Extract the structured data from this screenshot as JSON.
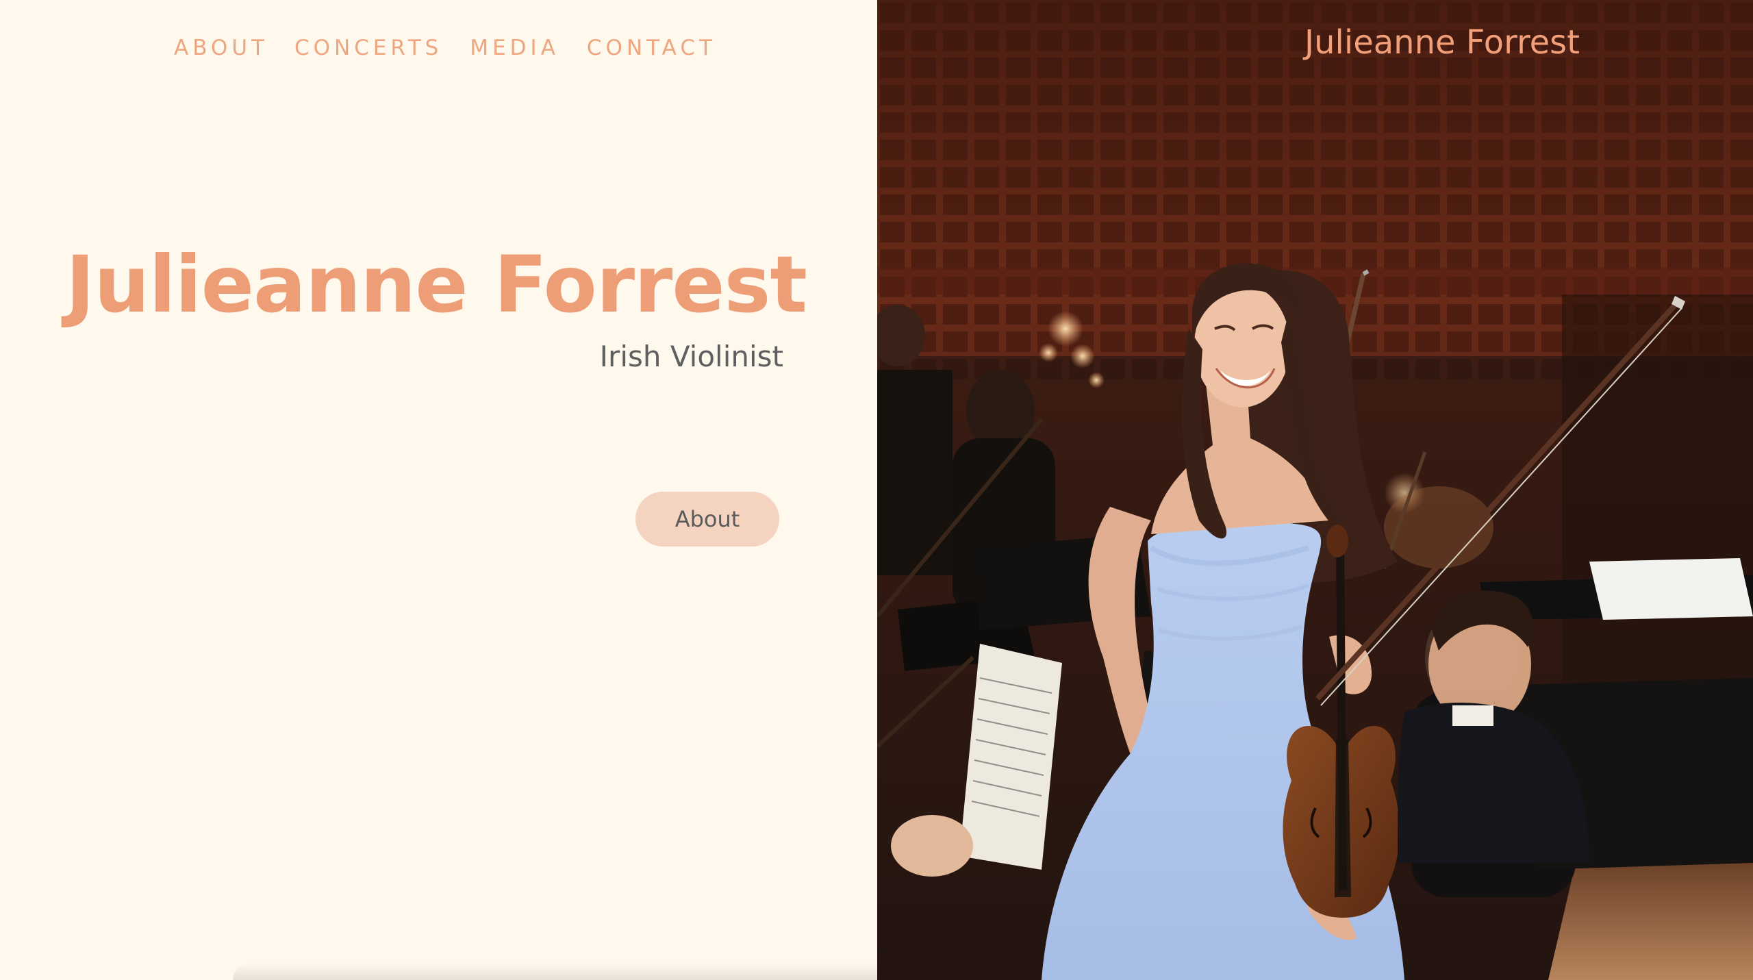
{
  "nav": {
    "items": [
      {
        "label": "ABOUT"
      },
      {
        "label": "CONCERTS"
      },
      {
        "label": "MEDIA"
      },
      {
        "label": "CONTACT"
      }
    ]
  },
  "hero": {
    "title": "Julieanne Forrest",
    "subtitle": "Irish Violinist",
    "button_label": "About"
  },
  "header": {
    "brand": "Julieanne Forrest"
  },
  "colors": {
    "left_background": "#fef8ed",
    "accent": "#ee9e76",
    "button_background": "#f4d3c0",
    "subtitle_text": "#5f5f5f"
  }
}
